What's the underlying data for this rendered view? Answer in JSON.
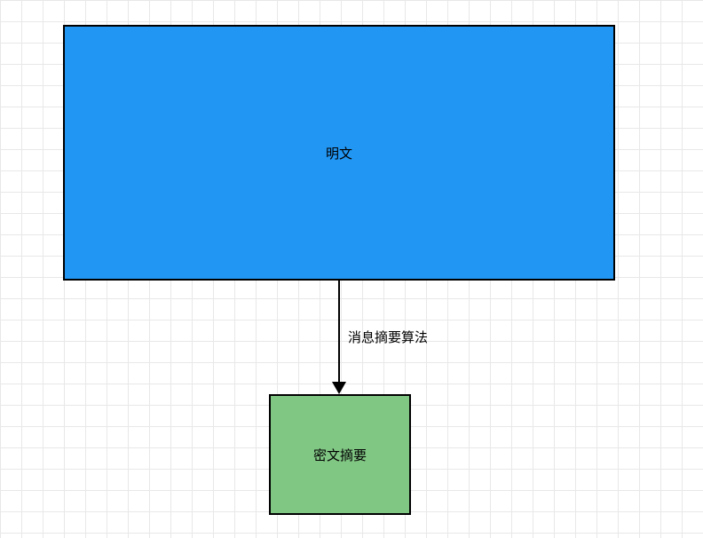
{
  "nodes": {
    "plaintext": {
      "label": "明文"
    },
    "ciphertext_digest": {
      "label": "密文摘要"
    }
  },
  "edge": {
    "label": "消息摘要算法"
  }
}
